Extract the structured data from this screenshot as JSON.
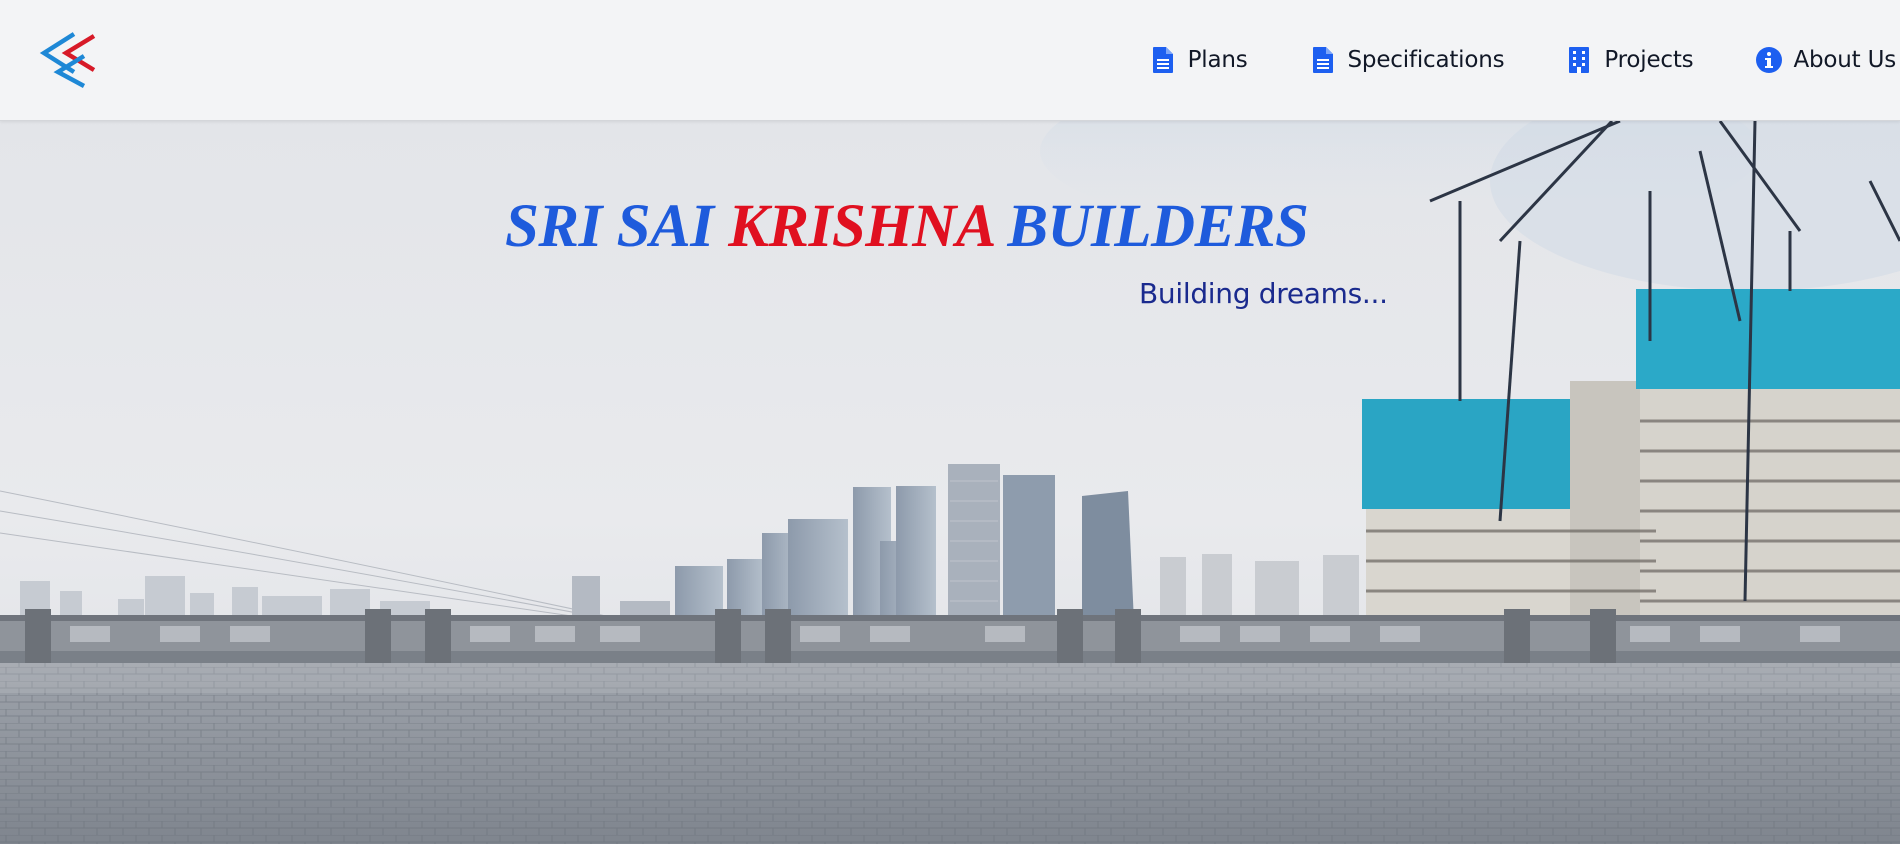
{
  "brand": {
    "logo_icon": "chevron-double-left-logo",
    "colors": {
      "blue": "#1e5bdc",
      "red": "#e01020",
      "navy": "#1a2a8e"
    }
  },
  "nav": {
    "items": [
      {
        "label": "Plans",
        "icon": "file-text-icon"
      },
      {
        "label": "Specifications",
        "icon": "file-text-icon"
      },
      {
        "label": "Projects",
        "icon": "building-icon"
      },
      {
        "label": "About Us",
        "icon": "info-circle-icon"
      }
    ],
    "icon_color": "#1d5ff0"
  },
  "hero": {
    "title_part1": "SRI SAI",
    "title_part2": "KRISHNA",
    "title_part3": "BUILDERS",
    "tagline": "Building dreams..."
  }
}
